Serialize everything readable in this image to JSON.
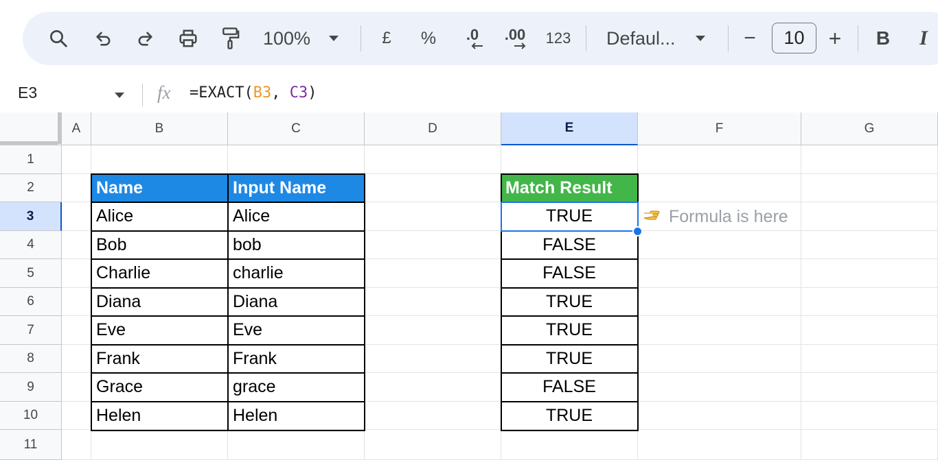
{
  "toolbar": {
    "zoom": "100%",
    "currency": "£",
    "percent": "%",
    "decrease_decimals": ".0",
    "increase_decimals": ".00",
    "number_format": "123",
    "font_family": "Defaul...",
    "font_size": "10",
    "minus": "−",
    "plus": "+",
    "bold": "B",
    "italic": "I"
  },
  "formula_bar": {
    "cell_ref": "E3",
    "fx": "fx",
    "formula_prefix": "=EXACT(",
    "ref_1": "B3",
    "separator": ", ",
    "ref_2": "C3",
    "formula_suffix": ")"
  },
  "columns": [
    "A",
    "B",
    "C",
    "D",
    "E",
    "F",
    "G"
  ],
  "rows": [
    "1",
    "2",
    "3",
    "4",
    "5",
    "6",
    "7",
    "8",
    "9",
    "10",
    "11"
  ],
  "table": {
    "header_name": "Name",
    "header_input": "Input Name",
    "header_result": "Match Result",
    "names": [
      "Alice",
      "Bob",
      "Charlie",
      "Diana",
      "Eve",
      "Frank",
      "Grace",
      "Helen"
    ],
    "inputs": [
      "Alice",
      "bob",
      "charlie",
      "Diana",
      "Eve",
      "Frank",
      "grace",
      "Helen"
    ],
    "results": [
      "TRUE",
      "FALSE",
      "FALSE",
      "TRUE",
      "TRUE",
      "TRUE",
      "FALSE",
      "TRUE"
    ]
  },
  "annotation": {
    "icon": "pointing-hand-icon",
    "text": "Formula is here"
  },
  "colors": {
    "header_blue": "#1e88e5",
    "header_green": "#43b649",
    "selection": "#1a73e8",
    "toolbar_bg": "#edf2fa",
    "ref_b": "#e69a2a",
    "ref_c": "#7b2ea8"
  }
}
